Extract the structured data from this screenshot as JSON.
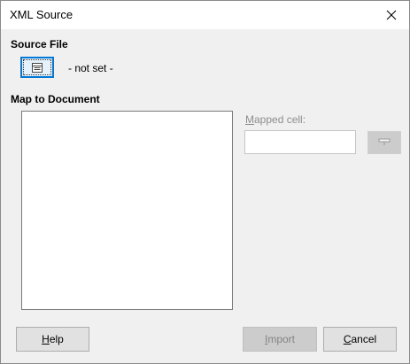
{
  "window": {
    "title": "XML Source",
    "close_icon": "close-icon"
  },
  "source_file": {
    "label": "Source File",
    "button_icon": "browse-file-icon",
    "status": "- not set -"
  },
  "map_to_document": {
    "label": "Map to Document"
  },
  "mapped_cell": {
    "label_mnemonic": "M",
    "label_rest": "apped cell:",
    "value": "",
    "enabled": false,
    "ref_button_icon": "shrink-reference-icon"
  },
  "buttons": {
    "help": {
      "mnemonic": "H",
      "rest": "elp",
      "enabled": true
    },
    "import": {
      "mnemonic": "I",
      "rest": "mport",
      "enabled": false
    },
    "cancel": {
      "mnemonic": "C",
      "rest": "ancel",
      "enabled": true
    }
  },
  "colors": {
    "focus_border": "#0078d7",
    "disabled_text": "#8d8d8d",
    "dialog_bg": "#f0f0f0"
  }
}
